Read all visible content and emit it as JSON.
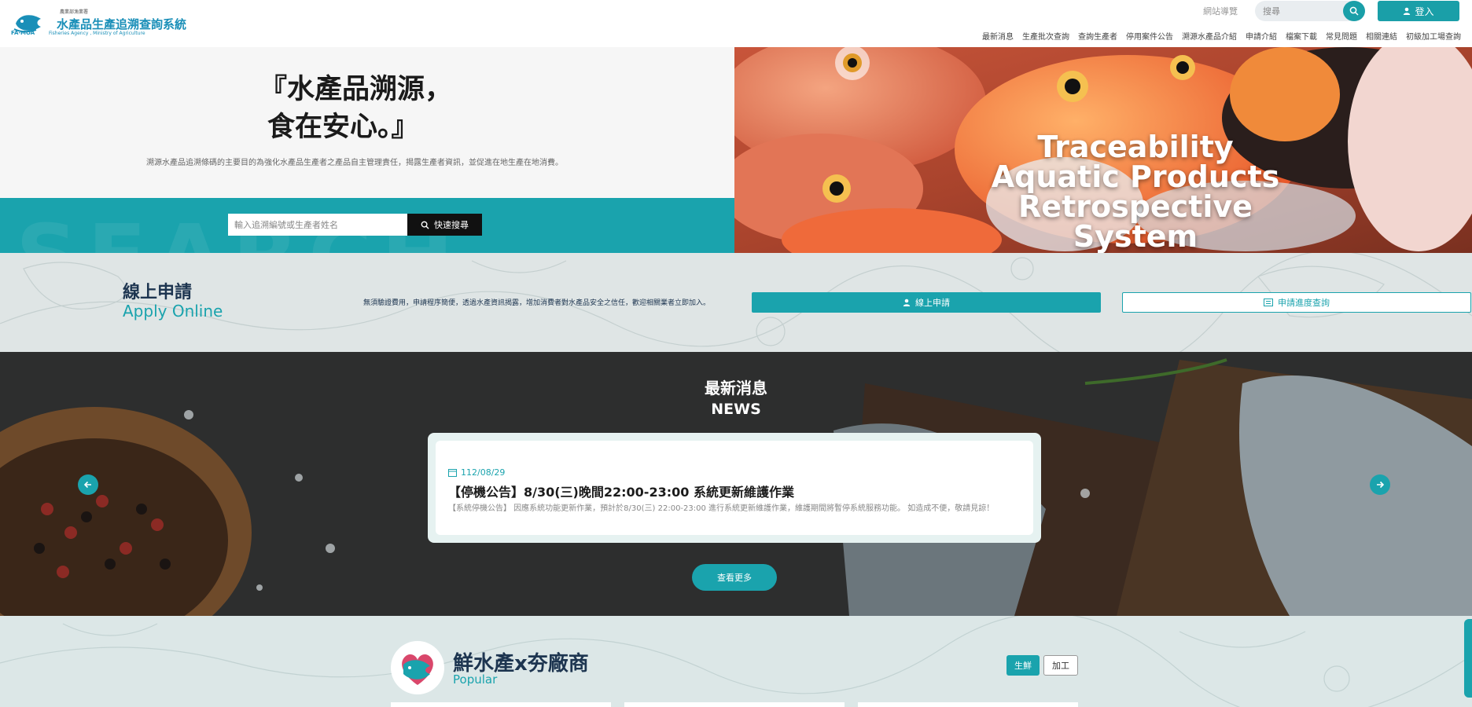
{
  "header": {
    "ministry": "農業部漁業署",
    "system_title": "水產品生產追溯查詢系統",
    "fa_moa": "FA∙MOA",
    "agency_en": "Fisheries Agency , Ministry of Agriculture",
    "sitemap": "網站導覽",
    "search_placeholder": "搜尋",
    "login": "登入",
    "nav": [
      "最新消息",
      "生產批次查詢",
      "查詢生產者",
      "停用案件公告",
      "溯源水產品介紹",
      "申請介紹",
      "檔案下載",
      "常見問題",
      "相關連結",
      "初級加工場查詢"
    ]
  },
  "hero": {
    "title_line1": "『水產品溯源，",
    "title_line2": "食在安心。』",
    "description": "溯源水產品追溯條碼的主要目的為強化水產品生產者之產品自主管理責任，揭露生產者資訊，並促進在地生產在地消費。",
    "watermark": "SEARCH",
    "quick_search_placeholder": "輸入追溯編號或生產者姓名",
    "quick_search_button": "快速搜尋",
    "english_line1": "Traceability",
    "english_line2": "Aquatic Products",
    "english_line3": "Retrospective System"
  },
  "apply": {
    "title_zh": "線上申請",
    "title_en": "Apply Online",
    "description": "無須驗證費用，申請程序簡便，透過水產資訊揭露，增加消費者對水產品安全之信任，歡迎相關業者立即加入。",
    "apply_button": "線上申請",
    "progress_button": "申請進度查詢"
  },
  "news": {
    "title_zh": "最新消息",
    "title_en": "NEWS",
    "items": [
      {
        "date": "112/08/29",
        "headline": "【停機公告】8/30(三)晚間22:00-23:00 系統更新維護作業",
        "body": "【系統停機公告】 因應系統功能更新作業，預計於8/30(三) 22:00-23:00 進行系統更新維護作業，維護期間將暫停系統服務功能。 如造成不便，敬請見諒！"
      }
    ],
    "more_button": "查看更多"
  },
  "popular": {
    "title": "鮮水產x夯廠商",
    "subtitle": "Popular",
    "tab_fresh": "生鮮",
    "tab_processed": "加工"
  },
  "colors": {
    "teal": "#1aa3ad",
    "navy": "#1d3550",
    "logo_blue": "#1a8fb8"
  }
}
